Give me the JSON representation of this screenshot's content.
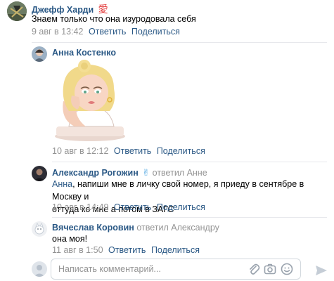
{
  "comments": [
    {
      "author": "Джефф Харди",
      "badge": "愛",
      "text": "Знаем только что она изуродовала себя",
      "date": "9 авг в 13:42",
      "reply_label": "Ответить",
      "share_label": "Поделиться"
    },
    {
      "author": "Анна Костенко",
      "date": "10 авг в 12:12",
      "reply_label": "Ответить",
      "share_label": "Поделиться"
    },
    {
      "author": "Александр Рогожин",
      "badge": "✌",
      "reply_to": "ответил Анне",
      "mention": "Анна",
      "text": ", напиши мне в личку свой номер, я приеду в сентябре в Москву и",
      "text2": "оттуда ко мне а потом в ЗАГС",
      "date": "10 авг в 14:49",
      "reply_label": "Ответить",
      "share_label": "Поделиться"
    },
    {
      "author": "Вячеслав Коровин",
      "reply_to": "ответил Александру",
      "text": "она моя!",
      "date": "11 авг в 1:50",
      "reply_label": "Ответить",
      "share_label": "Поделиться"
    }
  ],
  "composer": {
    "placeholder": "Написать комментарий..."
  },
  "colors": {
    "link": "#2a5885",
    "muted": "#939393",
    "icon": "#99a2ad"
  }
}
